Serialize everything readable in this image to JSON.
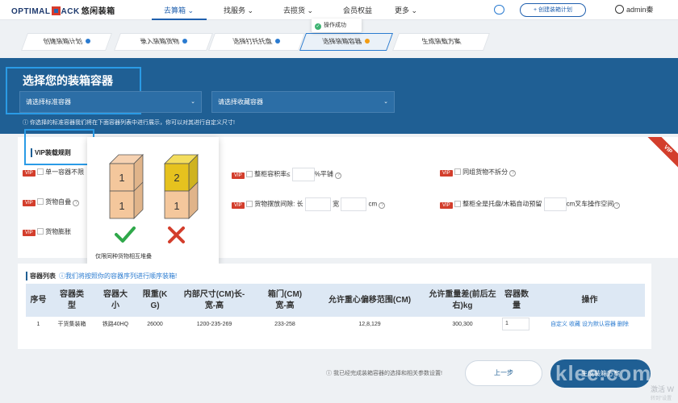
{
  "brand": {
    "latin": "OPTIMAL PACK",
    "latin_a": "OPTIMAL",
    "latin_b": "ACK",
    "cn": "悠闲装箱"
  },
  "nav": {
    "items": [
      {
        "label": "去算箱",
        "caret": "⌄"
      },
      {
        "label": "找服务",
        "caret": "⌄"
      },
      {
        "label": "去揽货",
        "caret": "⌄"
      },
      {
        "label": "会员权益",
        "caret": ""
      },
      {
        "label": "更多",
        "caret": "⌄"
      }
    ],
    "create_plan": "+ 创建装箱计划",
    "user": "admin秦"
  },
  "toast": {
    "text": "操作成功",
    "icon": "check-circle-icon"
  },
  "steps": [
    {
      "label": "创建装箱计划",
      "dot": "blue"
    },
    {
      "label": "录入装箱货物",
      "dot": "blue"
    },
    {
      "label": "选择打托托盘",
      "dot": "blue"
    },
    {
      "label": "选择装箱容器",
      "dot": "orange"
    },
    {
      "label": "生成装载方案",
      "dot": ""
    }
  ],
  "hero": {
    "title": "选择您的装箱容器",
    "select_standard": "请选择标准容器",
    "select_favorite": "请选择收藏容器",
    "hint": "ⓘ 你选择的标准容器我们将在下面容器列表中进行展示，你可以对其进行自定义尺寸!"
  },
  "vip_rules": {
    "title": "VIP装载规则",
    "tag": "VIP",
    "ribbon": "VIP",
    "rule_single_container": "单一容器不限",
    "rule_fill_rate": "整柜容积率≤",
    "fill_rate_unit": "%平铺",
    "rule_same_group": "同组货物不拆分",
    "rule_self_stack": "货物自叠",
    "rule_spacing": "货物摆放间隙:",
    "spacing_len": "长",
    "spacing_wid": "宽",
    "spacing_unit": "cm",
    "rule_pallet_reserve": "整柜全是托盘/木箱自动预留",
    "pallet_reserve_unit": "cm叉车操作空间",
    "rule_expansion": "货物膨胀"
  },
  "popup": {
    "left_top": "1",
    "left_bottom": "1",
    "right_top": "2",
    "right_bottom": "1",
    "caption": "仅限同种货物相互堆叠"
  },
  "container_list": {
    "title": "容器列表",
    "subtitle": "ⓘ我们将按照你的容器序列进行顺序装箱!",
    "headers": [
      [
        "序号"
      ],
      [
        "容器类",
        "型"
      ],
      [
        "容器大",
        "小"
      ],
      [
        "限重(K",
        "G)"
      ],
      [
        "内部尺寸(CM)长-",
        "宽-高"
      ],
      [
        "箱门(CM)",
        "宽-高"
      ],
      [
        "允许重心偏移范围(CM)"
      ],
      [
        "允许重量差(前后左",
        "右)kg"
      ],
      [
        "容器数",
        "量"
      ],
      [
        "操作"
      ]
    ],
    "row": {
      "index": "1",
      "type": "干货集装箱",
      "size": "铁路40HQ",
      "weight_limit": "26000",
      "inner_size": "1200-235-269",
      "door": "233-258",
      "cg_offset": "12,8,129",
      "weight_diff": "300,300",
      "qty": "1",
      "actions": [
        "自定义",
        "收藏",
        "设为默认容器",
        "删除"
      ]
    }
  },
  "footer": {
    "hint": "ⓘ 我已经完成装箱容器的选择和相关参数设置!",
    "prev": "上一步",
    "next": "生成装箱方案",
    "watermark": "klee.com",
    "watermark_side": "激活 W",
    "watermark_small": "转到\"设置"
  },
  "colors": {
    "primary": "#1f5f94",
    "vip_red": "#d33e2c",
    "link": "#2a7bd0",
    "orange": "#f39c12",
    "green": "#3cb371"
  }
}
